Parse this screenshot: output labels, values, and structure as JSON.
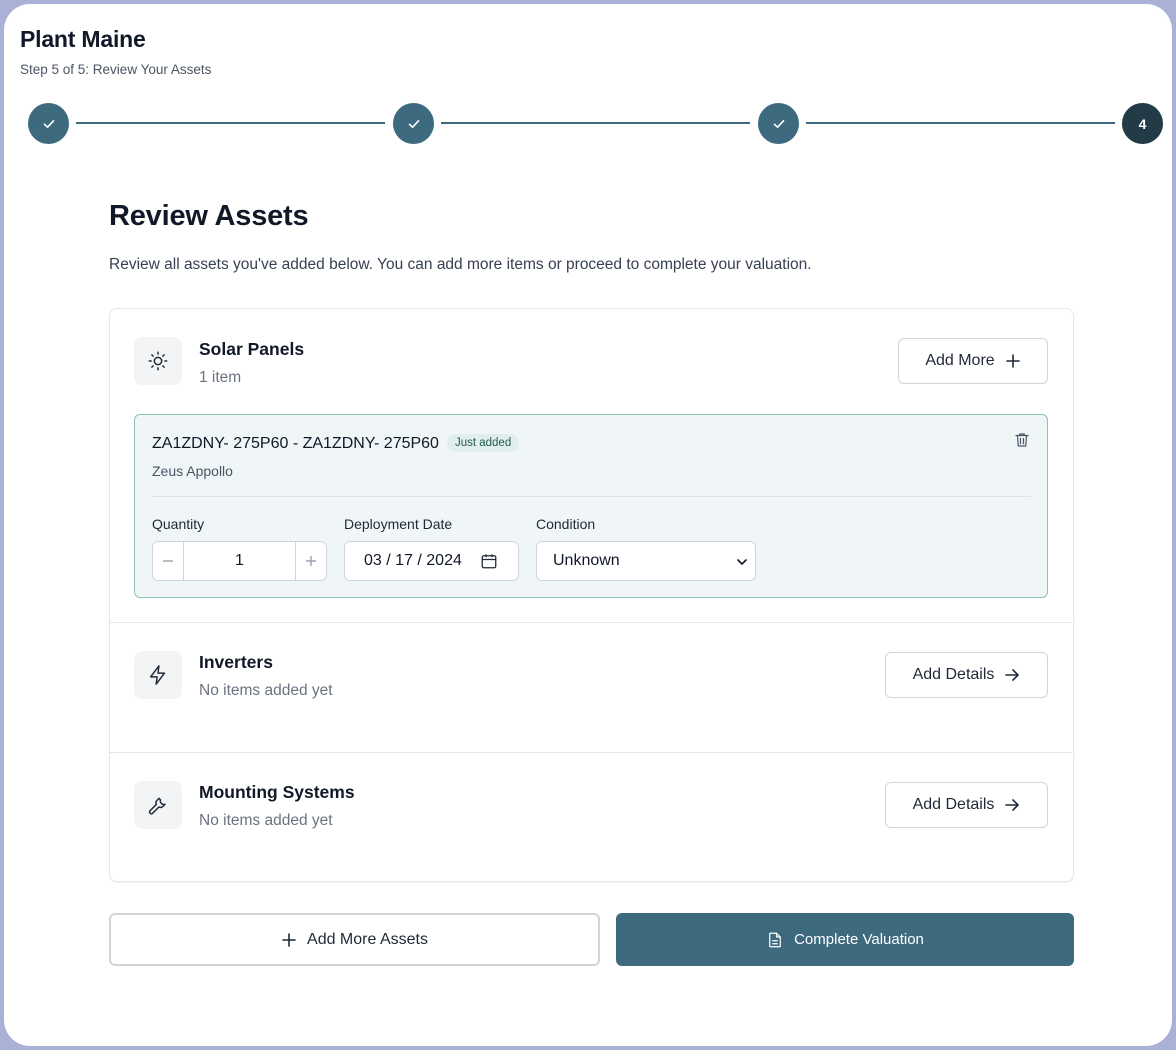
{
  "header": {
    "title": "Plant Maine",
    "step_text": "Step 5 of 5: Review Your Assets"
  },
  "stepper": {
    "current_label": "4",
    "completed_steps": 3
  },
  "main": {
    "title": "Review Assets",
    "description": "Review all assets you've added below. You can add more items or proceed to complete your valuation."
  },
  "sections": {
    "solar": {
      "title": "Solar Panels",
      "count": "1 item",
      "button_label": "Add More",
      "icon": "sun-icon"
    },
    "inverters": {
      "title": "Inverters",
      "status": "No items added yet",
      "button_label": "Add Details",
      "icon": "bolt-icon"
    },
    "mounting": {
      "title": "Mounting Systems",
      "status": "No items added yet",
      "button_label": "Add Details",
      "icon": "wrench-icon"
    }
  },
  "item": {
    "name": "ZA1ZDNY- 275P60 - ZA1ZDNY- 275P60",
    "badge": "Just added",
    "manufacturer": "Zeus Appollo",
    "quantity_label": "Quantity",
    "quantity_value": "1",
    "date_label": "Deployment Date",
    "date_value": "03 / 17 / 2024",
    "condition_label": "Condition",
    "condition_value": "Unknown"
  },
  "actions": {
    "add_more_assets": "Add More Assets",
    "complete_valuation": "Complete Valuation"
  },
  "colors": {
    "accent": "#3e6a7f",
    "current_step": "#233a47",
    "item_border": "#8cc2b8",
    "item_bg": "#f0f5f7"
  }
}
